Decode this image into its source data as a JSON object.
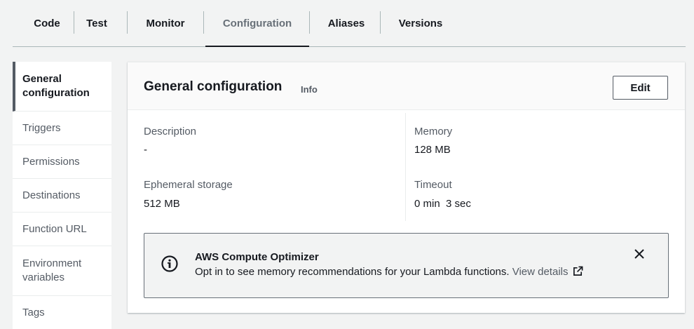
{
  "tabs": [
    {
      "label": "Code"
    },
    {
      "label": "Test"
    },
    {
      "label": "Monitor"
    },
    {
      "label": "Configuration",
      "active": true
    },
    {
      "label": "Aliases"
    },
    {
      "label": "Versions"
    }
  ],
  "sidenav": {
    "items": [
      {
        "label": "General configuration",
        "active": true
      },
      {
        "label": "Triggers"
      },
      {
        "label": "Permissions"
      },
      {
        "label": "Destinations"
      },
      {
        "label": "Function URL"
      },
      {
        "label": "Environment variables"
      },
      {
        "label": "Tags"
      }
    ]
  },
  "panel": {
    "title": "General configuration",
    "info_label": "Info",
    "edit_label": "Edit",
    "description": {
      "label": "Description",
      "value": "-"
    },
    "memory": {
      "label": "Memory",
      "value": "128 MB"
    },
    "ephemeral_storage": {
      "label": "Ephemeral storage",
      "value": "512 MB"
    },
    "timeout": {
      "label": "Timeout",
      "value": "0 min  3 sec"
    }
  },
  "alert": {
    "icon": "info-circle-icon",
    "title": "AWS Compute Optimizer",
    "text": "Opt in to see memory recommendations for your Lambda functions.",
    "link_label": "View details",
    "link_icon": "external-link-icon",
    "close_icon": "close-icon"
  }
}
